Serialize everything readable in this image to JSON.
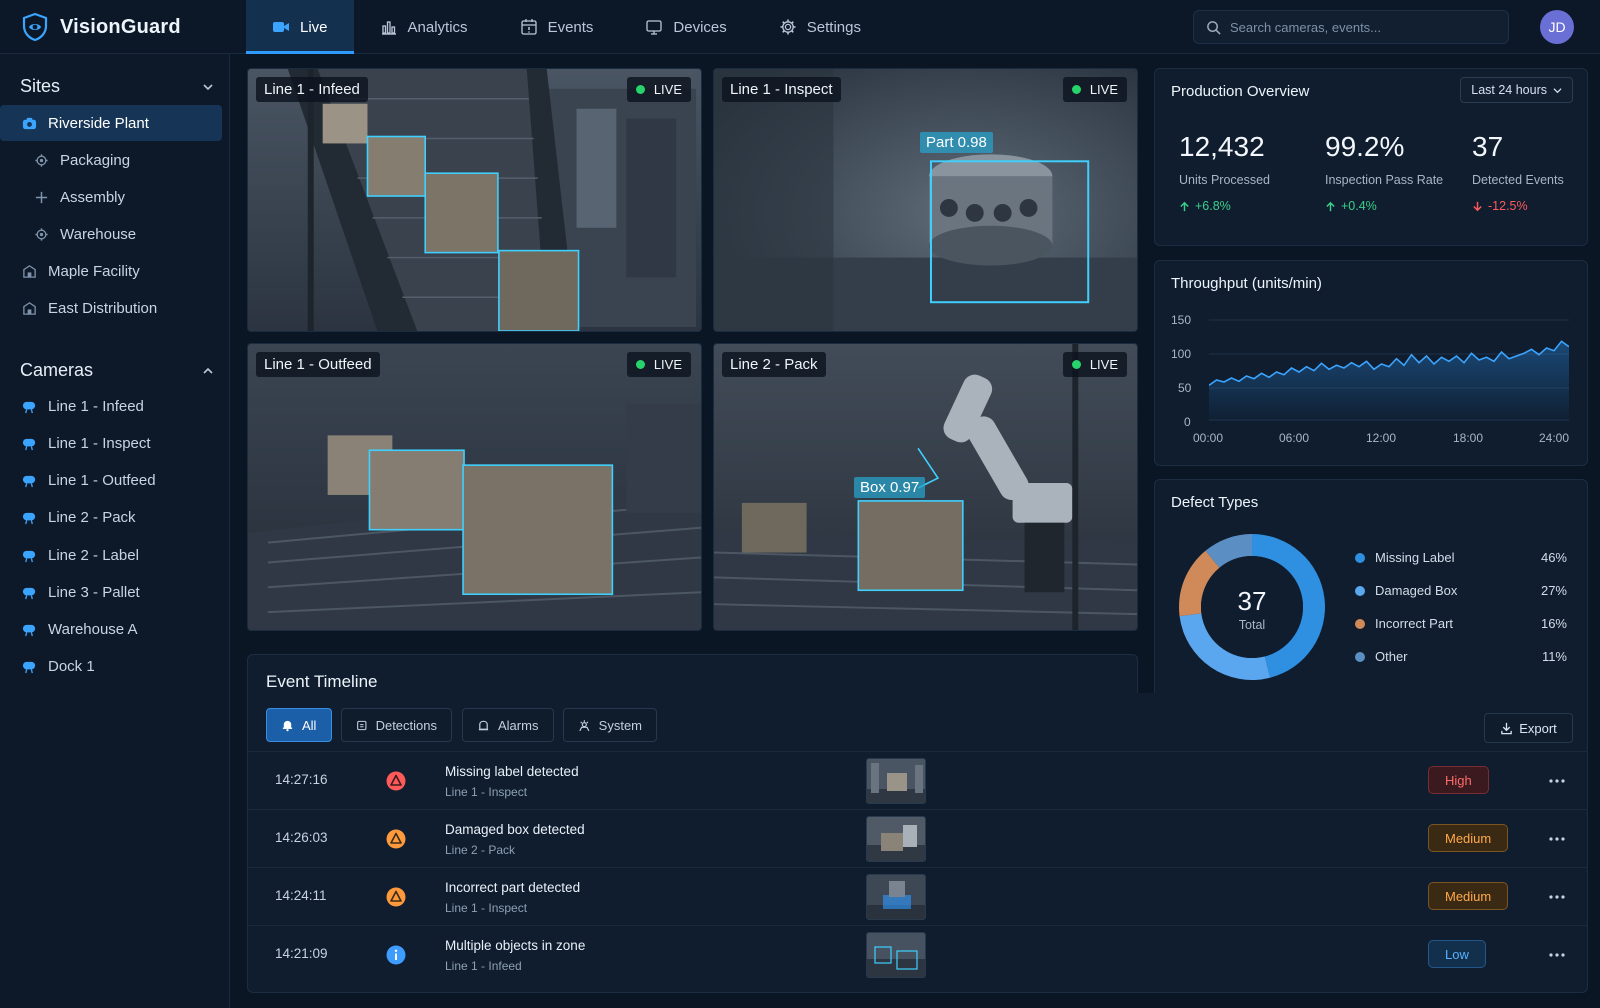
{
  "app": {
    "name": "VisionGuard",
    "logo_icon": "shield-eye-icon",
    "accent": "#2f9bff"
  },
  "nav": {
    "tabs": [
      {
        "label": "Live",
        "icon": "video-camera-icon",
        "active": true
      },
      {
        "label": "Analytics",
        "icon": "bar-chart-icon",
        "active": false
      },
      {
        "label": "Events",
        "icon": "calendar-alert-icon",
        "active": false
      },
      {
        "label": "Devices",
        "icon": "monitor-icon",
        "active": false
      },
      {
        "label": "Settings",
        "icon": "gear-icon",
        "active": false
      }
    ]
  },
  "search": {
    "placeholder": "Search cameras, events..."
  },
  "user": {
    "initials": "JD"
  },
  "sidebar": {
    "sites_title": "Sites",
    "sites": [
      {
        "label": "Riverside Plant",
        "active": true,
        "icon": "camera-icon"
      },
      {
        "label": "Packaging",
        "child": true,
        "icon": "gear-icon"
      },
      {
        "label": "Assembly",
        "child": true,
        "icon": "plus-icon"
      },
      {
        "label": "Warehouse",
        "child": true,
        "icon": "gear-icon"
      },
      {
        "label": "Maple Facility",
        "icon": "building-icon"
      },
      {
        "label": "East Distribution",
        "icon": "building-icon"
      }
    ],
    "cameras_title": "Cameras",
    "cameras": [
      {
        "label": "Line 1 - Infeed"
      },
      {
        "label": "Line 1 - Inspect"
      },
      {
        "label": "Line 1 - Outfeed"
      },
      {
        "label": "Line 2 - Pack"
      },
      {
        "label": "Line 2 - Label"
      },
      {
        "label": "Line 3 - Pallet"
      },
      {
        "label": "Warehouse A"
      },
      {
        "label": "Dock 1"
      }
    ]
  },
  "feeds": [
    {
      "label": "Line 1 - Infeed",
      "status": "LIVE"
    },
    {
      "label": "Line 1 - Inspect",
      "status": "LIVE",
      "detection": "Part 0.98"
    },
    {
      "label": "Line 1 - Outfeed",
      "status": "LIVE"
    },
    {
      "label": "Line 2 - Pack",
      "status": "LIVE",
      "detection": "Box 0.97"
    }
  ],
  "overview": {
    "title": "Production Overview",
    "range": "Last 24 hours",
    "kpis": [
      {
        "value": "12,432",
        "label": "Units Processed",
        "delta": "+6.8%",
        "direction": "up"
      },
      {
        "value": "99.2%",
        "label": "Inspection Pass Rate",
        "delta": "+0.4%",
        "direction": "up"
      },
      {
        "value": "37",
        "label": "Detected Events",
        "delta": "-12.5%",
        "direction": "down"
      }
    ]
  },
  "throughput": {
    "title": "Throughput (units/min)",
    "y_ticks": [
      "150",
      "100",
      "50",
      "0"
    ],
    "x_ticks": [
      "00:00",
      "06:00",
      "12:00",
      "18:00",
      "24:00"
    ]
  },
  "defects": {
    "title": "Defect Types",
    "total_value": "37",
    "total_label": "Total",
    "items": [
      {
        "label": "Missing Label",
        "pct": "46%",
        "color": "#2f8fe0"
      },
      {
        "label": "Damaged Box",
        "pct": "27%",
        "color": "#5aa7f0"
      },
      {
        "label": "Incorrect Part",
        "pct": "16%",
        "color": "#d08a5a"
      },
      {
        "label": "Other",
        "pct": "11%",
        "color": "#5b8fc4"
      }
    ]
  },
  "chart_data": [
    {
      "type": "line",
      "title": "Throughput (units/min)",
      "xlabel": "",
      "ylabel": "",
      "ylim": [
        0,
        150
      ],
      "x_ticks": [
        "00:00",
        "06:00",
        "12:00",
        "18:00",
        "24:00"
      ],
      "x": [
        0,
        0.5,
        1,
        1.5,
        2,
        2.5,
        3,
        3.5,
        4,
        4.5,
        5,
        5.5,
        6,
        6.5,
        7,
        7.5,
        8,
        8.5,
        9,
        9.5,
        10,
        10.5,
        11,
        11.5,
        12,
        12.5,
        13,
        13.5,
        14,
        14.5,
        15,
        15.5,
        16,
        16.5,
        17,
        17.5,
        18,
        18.5,
        19,
        19.5,
        20,
        20.5,
        21,
        21.5,
        22,
        22.5,
        23,
        23.5,
        24
      ],
      "series": [
        {
          "values": [
            52,
            60,
            57,
            63,
            58,
            66,
            62,
            70,
            64,
            72,
            68,
            78,
            72,
            80,
            74,
            85,
            76,
            82,
            78,
            86,
            80,
            88,
            76,
            84,
            80,
            92,
            82,
            98,
            86,
            96,
            84,
            94,
            88,
            96,
            86,
            100,
            90,
            94,
            88,
            102,
            92,
            96,
            100,
            106,
            98,
            108,
            104,
            118,
            110
          ]
        }
      ],
      "grid": true
    },
    {
      "type": "pie",
      "title": "Defect Types",
      "categories": [
        "Missing Label",
        "Damaged Box",
        "Incorrect Part",
        "Other"
      ],
      "values": [
        46,
        27,
        16,
        11
      ],
      "center_text": "37 Total",
      "legend": "right"
    }
  ],
  "timeline": {
    "title": "Event Timeline",
    "filters": [
      {
        "label": "All",
        "icon": "bell-icon",
        "active": true
      },
      {
        "label": "Detections",
        "icon": "scan-icon",
        "active": false
      },
      {
        "label": "Alarms",
        "icon": "alarm-icon",
        "active": false
      },
      {
        "label": "System",
        "icon": "system-icon",
        "active": false
      }
    ],
    "export_label": "Export",
    "events": [
      {
        "time": "14:27:16",
        "title": "Missing label detected",
        "camera": "Line 1 - Inspect",
        "severity": "High",
        "icon": "alert-triangle-icon",
        "icon_color": "#ff5a5a"
      },
      {
        "time": "14:26:03",
        "title": "Damaged box detected",
        "camera": "Line 2 - Pack",
        "severity": "Medium",
        "icon": "alert-triangle-icon",
        "icon_color": "#ff9a3c"
      },
      {
        "time": "14:24:11",
        "title": "Incorrect part detected",
        "camera": "Line 1 - Inspect",
        "severity": "Medium",
        "icon": "alert-triangle-icon",
        "icon_color": "#ff9a3c"
      },
      {
        "time": "14:21:09",
        "title": "Multiple objects in zone",
        "camera": "Line 1 - Infeed",
        "severity": "Low",
        "icon": "info-icon",
        "icon_color": "#3f9cff"
      }
    ]
  }
}
